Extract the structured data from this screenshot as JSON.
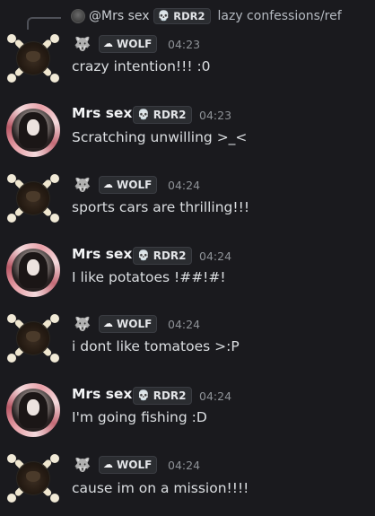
{
  "reply": {
    "author": "@Mrs sex",
    "author_tag": "RDR2",
    "text": "lazy confessions/ref"
  },
  "messages": [
    {
      "author": "",
      "avatar": "wolf-skull-avatar",
      "emoji": "wolf-emoji",
      "tag": "WOLF",
      "time": "04:23",
      "text": "crazy intention!!! :0"
    },
    {
      "author": "Mrs sex",
      "avatar": "anime-girl-avatar",
      "tag": "RDR2",
      "time": "04:23",
      "text": "Scratching unwilling >_<"
    },
    {
      "author": "",
      "avatar": "wolf-skull-avatar",
      "emoji": "wolf-emoji",
      "tag": "WOLF",
      "time": "04:24",
      "text": "sports cars are thrilling!!!"
    },
    {
      "author": "Mrs sex",
      "avatar": "anime-girl-avatar",
      "tag": "RDR2",
      "time": "04:24",
      "text": "I like potatoes !##!#!"
    },
    {
      "author": "",
      "avatar": "wolf-skull-avatar",
      "emoji": "wolf-emoji",
      "tag": "WOLF",
      "time": "04:24",
      "text": "i dont like tomatoes >:P"
    },
    {
      "author": "Mrs sex",
      "avatar": "anime-girl-avatar",
      "tag": "RDR2",
      "time": "04:24",
      "text": "I'm going fishing :D"
    },
    {
      "author": "",
      "avatar": "wolf-skull-avatar",
      "emoji": "wolf-emoji",
      "tag": "WOLF",
      "time": "04:24",
      "text": "cause im on a mission!!!!"
    }
  ],
  "colors": {
    "background": "#1a1a1e",
    "text": "#dbdee1",
    "timestamp": "#8e9297",
    "rdr_icon": "#ef4a5d"
  }
}
